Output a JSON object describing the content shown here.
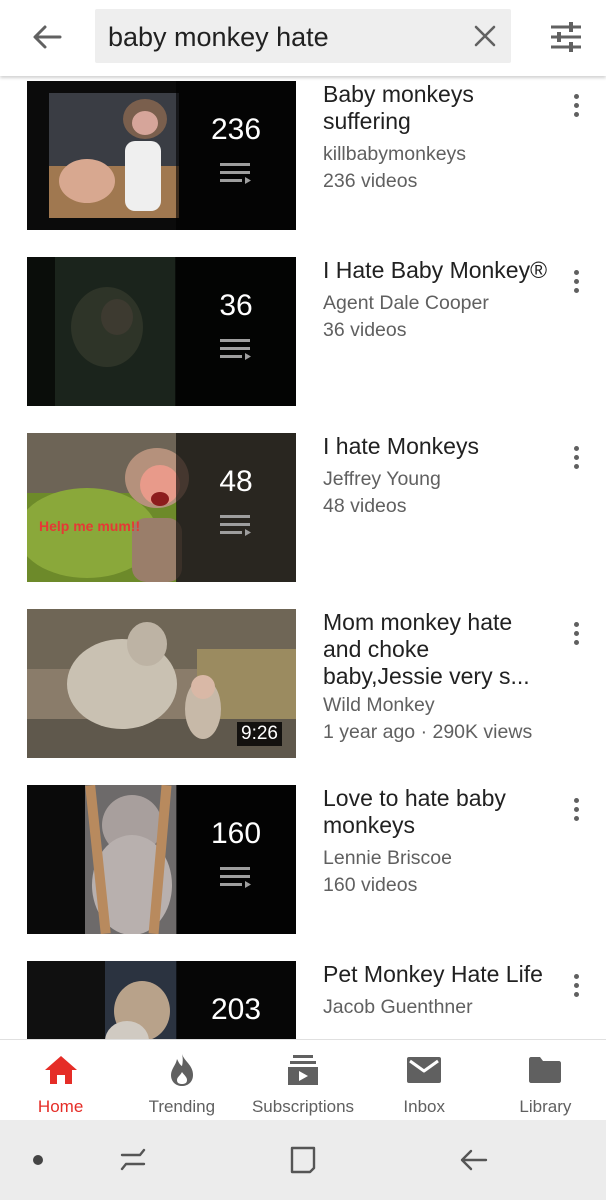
{
  "search": {
    "query": "baby monkey hate"
  },
  "results": [
    {
      "title": "Baby monkeys suffering",
      "channel": "killbabymonkeys",
      "info": "236 videos",
      "overlay": "236"
    },
    {
      "title": "I Hate Baby Monkey®",
      "channel": "Agent Dale Cooper",
      "info": "36 videos",
      "overlay": "36"
    },
    {
      "title": "I hate Monkeys",
      "channel": "Jeffrey Young",
      "info": "48 videos",
      "overlay": "48",
      "thumb_caption": "Help me mum!!"
    },
    {
      "title": "Mom monkey hate and choke baby,Jessie very s...",
      "channel": "Wild Monkey",
      "info": "1 year ago · 290K views",
      "duration": "9:26"
    },
    {
      "title": "Love to hate baby monkeys",
      "channel": "Lennie Briscoe",
      "info": "160 videos",
      "overlay": "160"
    },
    {
      "title": "Pet Monkey Hate Life",
      "channel": "Jacob Guenthner",
      "overlay": "203"
    }
  ],
  "nav": {
    "home": "Home",
    "trending": "Trending",
    "subscriptions": "Subscriptions",
    "inbox": "Inbox",
    "library": "Library"
  },
  "colors": {
    "accent": "#e52d27",
    "text_primary": "#212121",
    "text_secondary": "#606060",
    "search_bg": "#eeeeee"
  },
  "icons": {
    "back": "arrow-left-icon",
    "clear": "close-icon",
    "filter": "filter-sliders-icon",
    "more": "more-vert-icon",
    "playlist": "playlist-icon"
  }
}
